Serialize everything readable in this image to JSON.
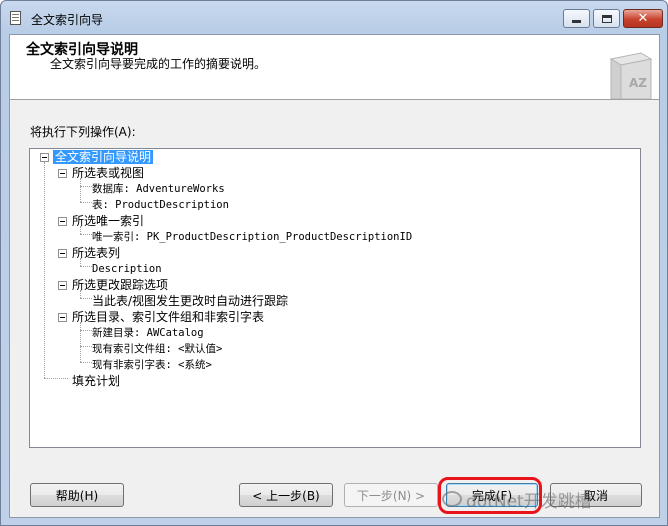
{
  "window": {
    "title": "全文索引向导",
    "close_glyph": "✕"
  },
  "header": {
    "title": "全文索引向导说明",
    "subtitle": "全文索引向导要完成的工作的摘要说明。",
    "graphic_text": "AZ"
  },
  "actions_label": "将执行下列操作(A):",
  "tree": {
    "root": "全文索引向导说明",
    "nodes": [
      {
        "label": "所选表或视图",
        "children": [
          "数据库: AdventureWorks",
          "表: ProductDescription"
        ]
      },
      {
        "label": "所选唯一索引",
        "children": [
          "唯一索引: PK_ProductDescription_ProductDescriptionID"
        ]
      },
      {
        "label": "所选表列",
        "children": [
          "Description"
        ]
      },
      {
        "label": "所选更改跟踪选项",
        "children": [
          "当此表/视图发生更改时自动进行跟踪"
        ]
      },
      {
        "label": "所选目录、索引文件组和非索引字表",
        "children": [
          "新建目录: AWCatalog",
          "现有索引文件组: <默认值>",
          "现有非索引字表: <系统>"
        ]
      },
      {
        "label": "填充计划",
        "children": []
      }
    ]
  },
  "buttons": {
    "help": "帮助(H)",
    "back": "< 上一步(B)",
    "next": "下一步(N) >",
    "finish": "完成(F)",
    "cancel": "取消"
  },
  "watermark": "dotNet开发跳槽"
}
